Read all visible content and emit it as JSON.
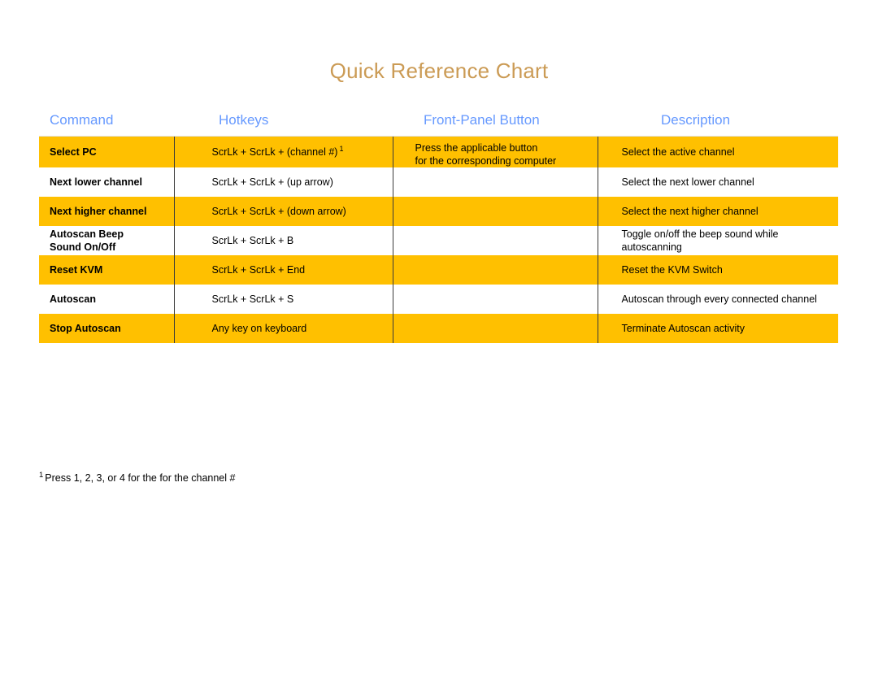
{
  "document": {
    "title": "Quick Reference Chart",
    "title_color": "#cb9b55",
    "accent_row_color": "#ffc000",
    "header_text_color": "#6699ff"
  },
  "table": {
    "headers": {
      "command": "Command",
      "hotkeys": "Hotkeys",
      "front_panel": "Front-Panel Button",
      "description": "Description"
    },
    "rows": [
      {
        "shaded": true,
        "command": "Select PC",
        "hotkeys": "ScrLk + ScrLk + (channel #)",
        "hotkeys_superscript": "1",
        "front_panel_line1": "Press the applicable button",
        "front_panel_line2": "for the corresponding computer",
        "description_line1": "Select the active channel",
        "description_line2": ""
      },
      {
        "shaded": false,
        "command": "Next lower channel",
        "hotkeys": "ScrLk + ScrLk + (up arrow)",
        "hotkeys_superscript": "",
        "front_panel_line1": "",
        "front_panel_line2": "",
        "description_line1": "Select the next lower channel",
        "description_line2": ""
      },
      {
        "shaded": true,
        "command": "Next higher channel",
        "hotkeys": "ScrLk + ScrLk + (down arrow)",
        "hotkeys_superscript": "",
        "front_panel_line1": "",
        "front_panel_line2": "",
        "description_line1": "Select the next higher channel",
        "description_line2": ""
      },
      {
        "shaded": false,
        "command_line1": "Autoscan Beep",
        "command_line2": "Sound On/Off",
        "command": "",
        "hotkeys": "ScrLk + ScrLk + B",
        "hotkeys_superscript": "",
        "front_panel_line1": "",
        "front_panel_line2": "",
        "description_line1": "Toggle on/off the beep sound while",
        "description_line2": "autoscanning"
      },
      {
        "shaded": true,
        "command": "Reset KVM",
        "hotkeys": "ScrLk + ScrLk + End",
        "hotkeys_superscript": "",
        "front_panel_line1": "",
        "front_panel_line2": "",
        "description_line1": "Reset the KVM Switch",
        "description_line2": ""
      },
      {
        "shaded": false,
        "command": "Autoscan",
        "hotkeys": "ScrLk + ScrLk + S",
        "hotkeys_superscript": "",
        "front_panel_line1": "",
        "front_panel_line2": "",
        "description_line1": "Autoscan through every connected channel",
        "description_line2": ""
      },
      {
        "shaded": true,
        "command": "Stop Autoscan",
        "hotkeys": "Any key on keyboard",
        "hotkeys_superscript": "",
        "front_panel_line1": "",
        "front_panel_line2": "",
        "description_line1": "Terminate Autoscan activity",
        "description_line2": ""
      }
    ]
  },
  "footnote": {
    "marker": "1",
    "text": "Press 1, 2, 3, or 4 for the for the channel #"
  }
}
